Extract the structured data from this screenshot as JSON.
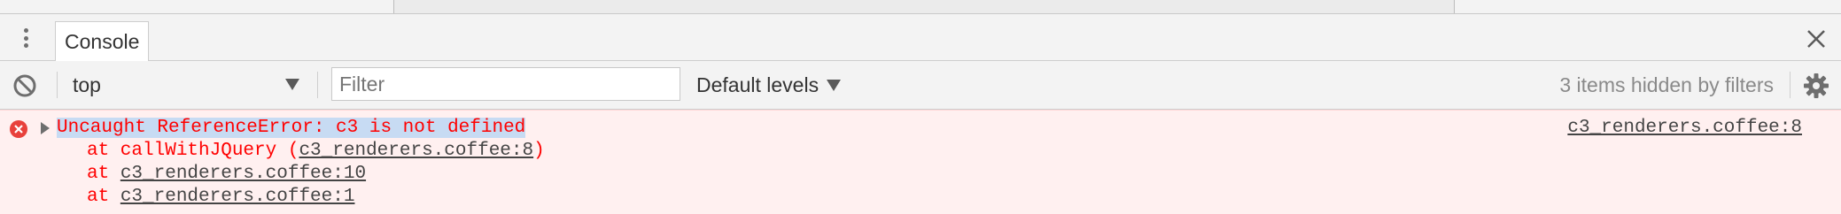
{
  "drawer": {
    "tab_label": "Console"
  },
  "toolbar": {
    "context_value": "top",
    "filter_placeholder": "Filter",
    "levels_label": "Default levels",
    "hidden_message": "3 items hidden by filters"
  },
  "messages": [
    {
      "level": "error",
      "text": "Uncaught ReferenceError: c3 is not defined",
      "source": "c3_renderers.coffee:8",
      "stack": [
        {
          "prefix": "at callWithJQuery (",
          "link": "c3_renderers.coffee:8",
          "suffix": ")"
        },
        {
          "prefix": "at ",
          "link": "c3_renderers.coffee:10",
          "suffix": ""
        },
        {
          "prefix": "at ",
          "link": "c3_renderers.coffee:1",
          "suffix": ""
        }
      ]
    }
  ],
  "colors": {
    "error_text": "#ff0000",
    "error_background": "#fff0f0",
    "selection_highlight": "#c7dbf3",
    "toolbar_background": "#f3f3f3"
  },
  "icons": {
    "menu": "kebab-menu-icon",
    "close": "close-icon",
    "clear": "clear-console-icon",
    "context_dropdown": "dropdown-caret-icon",
    "levels_dropdown": "dropdown-caret-icon",
    "settings": "gear-icon",
    "error": "error-icon",
    "expand": "expand-triangle-icon"
  }
}
